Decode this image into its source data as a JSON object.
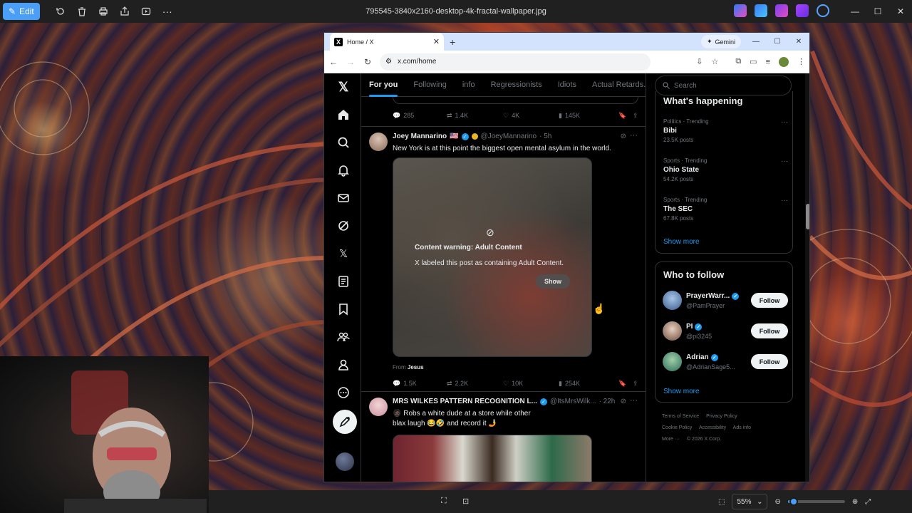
{
  "photos": {
    "edit_label": "Edit",
    "file_title": "795545-3840x2160-desktop-4k-fractal-wallpaper.jpg",
    "zoom_value": "55%",
    "zoom_fraction": 0.05
  },
  "chrome": {
    "tab_title": "Home / X",
    "gemini_label": "Gemini",
    "url": "x.com/home"
  },
  "x": {
    "tabs": [
      "For you",
      "Following",
      "info",
      "Regressionists",
      "Idiots",
      "Actual Retards."
    ],
    "prev_tweet_actions": {
      "replies": "285",
      "reposts": "1.4K",
      "likes": "4K",
      "views": "145K"
    },
    "tweet1": {
      "name": "Joey Mannarino",
      "flags": "🇺🇸",
      "handle": "@JoeyMannarino",
      "time": "· 5h",
      "text": "New York is at this point the biggest open mental asylum in the world.",
      "cw_title": "Content warning: Adult Content",
      "cw_desc": "X labeled this post as containing Adult Content.",
      "show_label": "Show",
      "from_prefix": "From",
      "from_name": "Jesus",
      "replies": "1.5K",
      "reposts": "2.2K",
      "likes": "10K",
      "views": "254K"
    },
    "tweet2": {
      "name": "MRS WILKES PATTERN RECOGNITION L...",
      "handle": "@ItsMrsWilk...",
      "time": "· 22h",
      "text_line1": "🧔🏿 Robs a white dude at a store while other",
      "text_line2": "blax laugh 😂🤣 and record it 🤳"
    },
    "search_placeholder": "Search",
    "whats_happening": "What's happening",
    "trends": [
      {
        "category": "Politics · Trending",
        "name": "Bibi",
        "count": "23.5K posts"
      },
      {
        "category": "Sports · Trending",
        "name": "Ohio State",
        "count": "54.2K posts"
      },
      {
        "category": "Sports · Trending",
        "name": "The SEC",
        "count": "67.8K posts"
      }
    ],
    "show_more": "Show more",
    "who_to_follow": "Who to follow",
    "follow_suggestions": [
      {
        "name": "PrayerWarr...",
        "handle": "@PamPrayer"
      },
      {
        "name": "PI",
        "handle": "@pi3245"
      },
      {
        "name": "Adrian",
        "handle": "@AdrianSage5..."
      }
    ],
    "follow_label": "Follow",
    "show_more_2": "Show more",
    "footer": [
      "Terms of Service",
      "Privacy Policy",
      "Cookie Policy",
      "Accessibility",
      "Ads info",
      "More ···",
      "© 2026 X Corp."
    ]
  }
}
